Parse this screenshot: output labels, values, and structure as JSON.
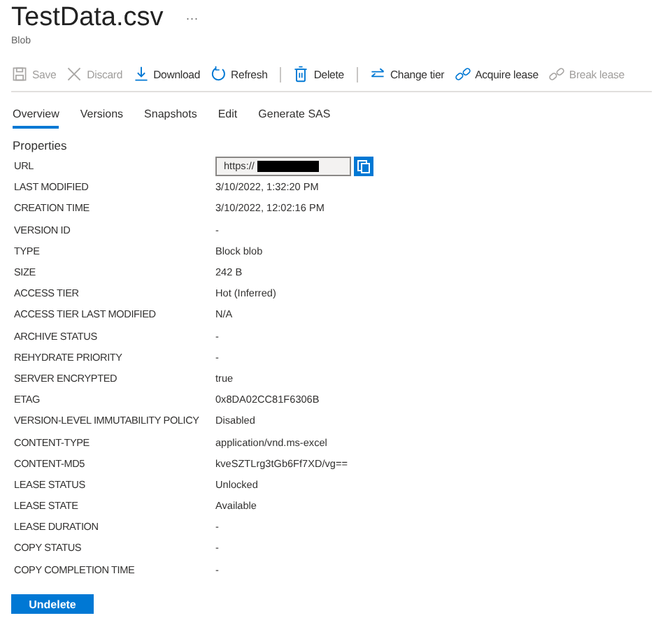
{
  "header": {
    "title": "TestData.csv",
    "more": "···",
    "subtitle": "Blob"
  },
  "toolbar": [
    [
      {
        "label": "Save",
        "disabled": true
      },
      {
        "label": "Discard",
        "disabled": true
      },
      {
        "label": "Download",
        "disabled": false
      },
      {
        "label": "Refresh",
        "disabled": false
      }
    ],
    [
      {
        "label": "Delete",
        "disabled": false
      }
    ],
    [
      {
        "label": "Change tier",
        "disabled": false
      },
      {
        "label": "Acquire lease",
        "disabled": false
      },
      {
        "label": "Break lease",
        "disabled": true
      }
    ]
  ],
  "tabs": [
    {
      "label": "Overview",
      "selected": true
    },
    {
      "label": "Versions",
      "selected": false
    },
    {
      "label": "Snapshots",
      "selected": false
    },
    {
      "label": "Edit",
      "selected": false
    },
    {
      "label": "Generate SAS",
      "selected": false
    }
  ],
  "properties": {
    "heading": "Properties",
    "rows": [
      {
        "kind": "url",
        "label": "URL",
        "value": "https://"
      },
      {
        "kind": "text",
        "label": "LAST MODIFIED",
        "value": "3/10/2022, 1:32:20 PM"
      },
      {
        "kind": "text",
        "label": "CREATION TIME",
        "value": "3/10/2022, 12:02:16 PM"
      },
      {
        "kind": "text",
        "label": "VERSION ID",
        "value": "-"
      },
      {
        "kind": "text",
        "label": "TYPE",
        "value": "Block blob"
      },
      {
        "kind": "text",
        "label": "SIZE",
        "value": "242 B"
      },
      {
        "kind": "text",
        "label": "ACCESS TIER",
        "value": "Hot (Inferred)"
      },
      {
        "kind": "text",
        "label": "ACCESS TIER LAST MODIFIED",
        "value": "N/A"
      },
      {
        "kind": "text",
        "label": "ARCHIVE STATUS",
        "value": "-"
      },
      {
        "kind": "text",
        "label": "REHYDRATE PRIORITY",
        "value": "-"
      },
      {
        "kind": "text",
        "label": "SERVER ENCRYPTED",
        "value": "true"
      },
      {
        "kind": "text",
        "label": "ETAG",
        "value": "0x8DA02CC81F6306B"
      },
      {
        "kind": "text",
        "label": "VERSION-LEVEL IMMUTABILITY POLICY",
        "value": "Disabled"
      },
      {
        "kind": "text",
        "label": "CONTENT-TYPE",
        "value": "application/vnd.ms-excel"
      },
      {
        "kind": "text",
        "label": "CONTENT-MD5",
        "value": "kveSZTLrg3tGb6Ff7XD/vg=="
      },
      {
        "kind": "text",
        "label": "LEASE STATUS",
        "value": "Unlocked"
      },
      {
        "kind": "text",
        "label": "LEASE STATE",
        "value": "Available"
      },
      {
        "kind": "text",
        "label": "LEASE DURATION",
        "value": "-"
      },
      {
        "kind": "text",
        "label": "COPY STATUS",
        "value": "-"
      },
      {
        "kind": "text",
        "label": "COPY COMPLETION TIME",
        "value": "-"
      }
    ]
  },
  "footer": {
    "button": "Undelete"
  }
}
